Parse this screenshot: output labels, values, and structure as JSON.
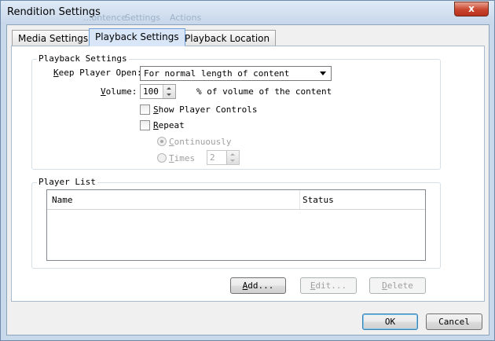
{
  "window": {
    "title": "Rendition Settings",
    "ghost_tabs": [
      "...ontence",
      "Settings",
      "Actions"
    ],
    "close_glyph": "x"
  },
  "tabs": [
    {
      "label": "Media Settings",
      "active": false
    },
    {
      "label": "Playback Settings",
      "active": true
    },
    {
      "label": "Playback Location",
      "active": false
    }
  ],
  "playback_settings": {
    "group_label": "Playback Settings",
    "keep_player_open": {
      "label_prefix": "",
      "label_mnemonic": "K",
      "label_rest": "eep Player Open:",
      "value": "For normal length of content"
    },
    "volume": {
      "label_mnemonic": "V",
      "label_rest": "olume:",
      "value": "100",
      "suffix": "% of  volume of  the content"
    },
    "show_player_controls": {
      "label_mnemonic": "S",
      "label_rest": "how Player Controls",
      "checked": false
    },
    "repeat": {
      "label_mnemonic": "R",
      "label_rest": "epeat",
      "checked": false
    },
    "continuously": {
      "label_mnemonic": "C",
      "label_rest": "ontinuously",
      "selected": true,
      "enabled": false
    },
    "times": {
      "label_mnemonic": "T",
      "label_rest": "imes",
      "selected": false,
      "enabled": false,
      "value": "2"
    }
  },
  "player_list": {
    "group_label": "Player List",
    "columns": [
      "Name",
      "Status"
    ],
    "rows": []
  },
  "list_buttons": {
    "add": {
      "mnemonic": "A",
      "rest": "dd...",
      "enabled": true
    },
    "edit": {
      "mnemonic": "E",
      "rest": "dit...",
      "enabled": false
    },
    "delete": {
      "mnemonic": "D",
      "rest": "elete",
      "enabled": false
    }
  },
  "dialog_buttons": {
    "ok": "OK",
    "cancel": "Cancel"
  },
  "colors": {
    "accent": "#6f9fd8",
    "close_button": "#c8452d"
  }
}
